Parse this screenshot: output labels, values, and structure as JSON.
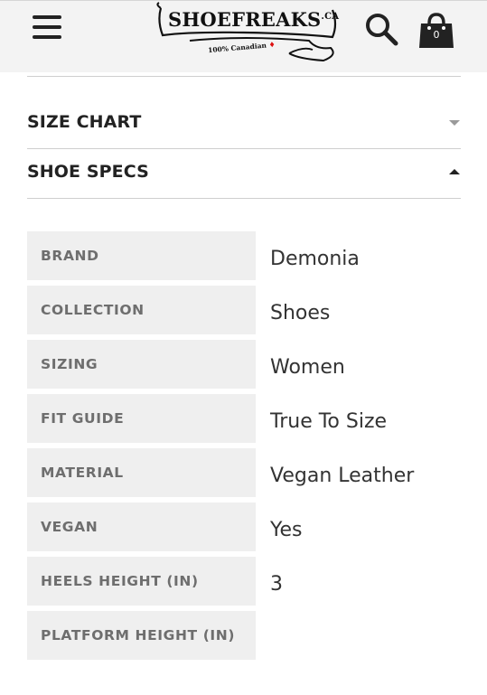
{
  "header": {
    "logo_text": "SHOEFREAKS",
    "logo_suffix": ".CA",
    "logo_subtitle": "100% Canadian",
    "cart_count": "0",
    "icons": {
      "menu": "hamburger-menu-icon",
      "search": "search-icon",
      "cart": "shopping-bag-icon"
    }
  },
  "accordions": [
    {
      "title": "SIZE CHART",
      "state": "collapsed"
    },
    {
      "title": "SHOE SPECS",
      "state": "expanded"
    }
  ],
  "specs": [
    {
      "label": "BRAND",
      "value": "Demonia"
    },
    {
      "label": "COLLECTION",
      "value": "Shoes"
    },
    {
      "label": "SIZING",
      "value": "Women"
    },
    {
      "label": "FIT GUIDE",
      "value": "True To Size"
    },
    {
      "label": "MATERIAL",
      "value": "Vegan Leather"
    },
    {
      "label": "VEGAN",
      "value": "Yes"
    },
    {
      "label": "HEELS HEIGHT (IN)",
      "value": "3"
    },
    {
      "label": "PLATFORM HEIGHT (IN)",
      "value": ""
    }
  ],
  "colors": {
    "header_bg": "#f3f3f3",
    "label_bg": "#efefef",
    "label_text": "#6e6e6e",
    "value_text": "#333333",
    "maple_leaf": "#dd1111"
  }
}
